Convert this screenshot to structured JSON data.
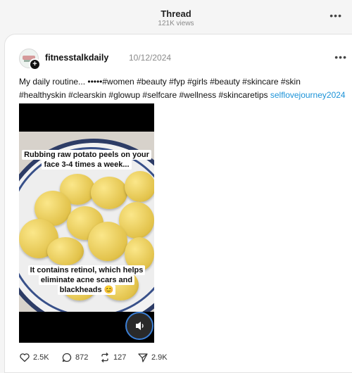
{
  "header": {
    "title": "Thread",
    "views": "121K views",
    "more_icon": "more-dots-icon"
  },
  "post": {
    "username": "fitnesstalkdaily",
    "date": "10/12/2024",
    "text_main": "My daily routine... •••••#women #beauty #fyp #girls #beauty #skincare #skin #healthyskin #clearskin #glowup #selfcare #wellness #skincaretips ",
    "text_link": "selflovejourney2024",
    "video": {
      "caption_top": "Rubbing raw potato peels on your face 3-4 times a week...",
      "caption_bottom": "It contains retinol, which helps eliminate acne scars and blackheads 😊",
      "sound_icon": "speaker-icon"
    },
    "stats": {
      "likes": "2.5K",
      "comments": "872",
      "reposts": "127",
      "shares": "2.9K"
    }
  },
  "colors": {
    "link": "#1c93d8",
    "sound_ring": "#3b7fd6",
    "bowl_rim": "#2d3c66"
  }
}
